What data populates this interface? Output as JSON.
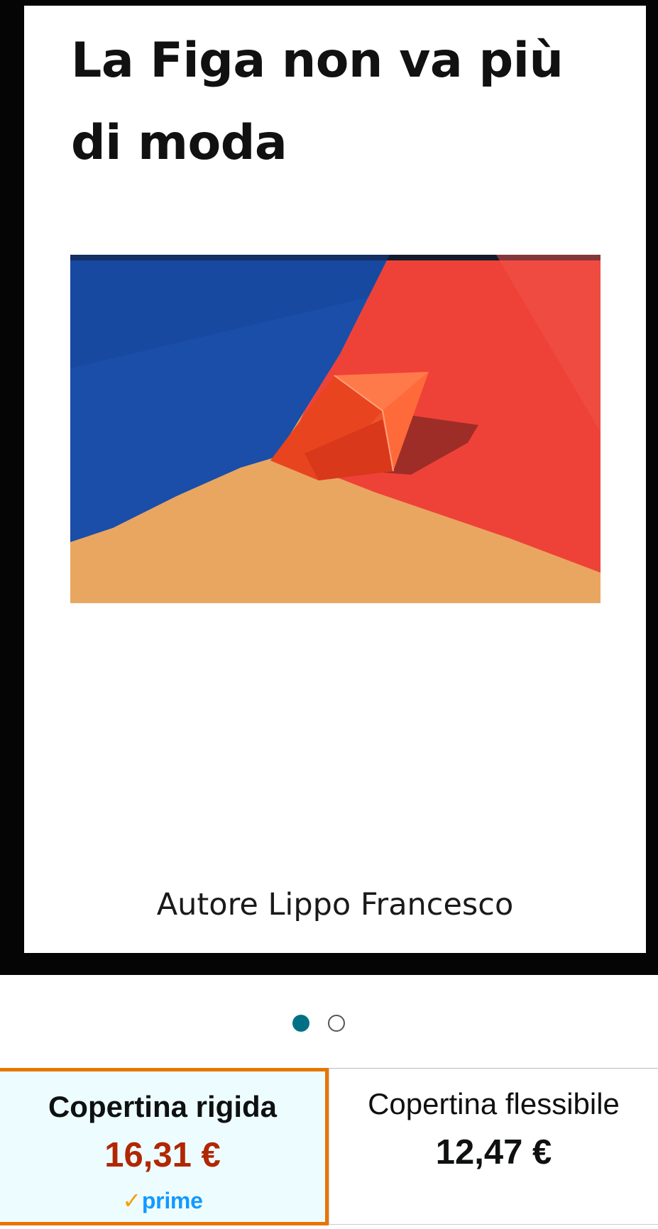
{
  "cover": {
    "title": "La Figa non va più di moda",
    "author": "Autore Lippo Francesco",
    "image_icon": "origami-paper-boat-image"
  },
  "carousel": {
    "count": 2,
    "active_index": 0
  },
  "formats": [
    {
      "label": "Copertina rigida",
      "price": "16,31 €",
      "badge": "prime",
      "badge_check": "✓",
      "selected": true
    },
    {
      "label": "Copertina flessibile",
      "price": "12,47 €",
      "selected": false
    }
  ],
  "colors": {
    "accent_teal": "#007185",
    "price_red": "#b12704",
    "selected_border": "#e77600",
    "prime_blue": "#1399ff",
    "prime_check": "#ff9900"
  }
}
